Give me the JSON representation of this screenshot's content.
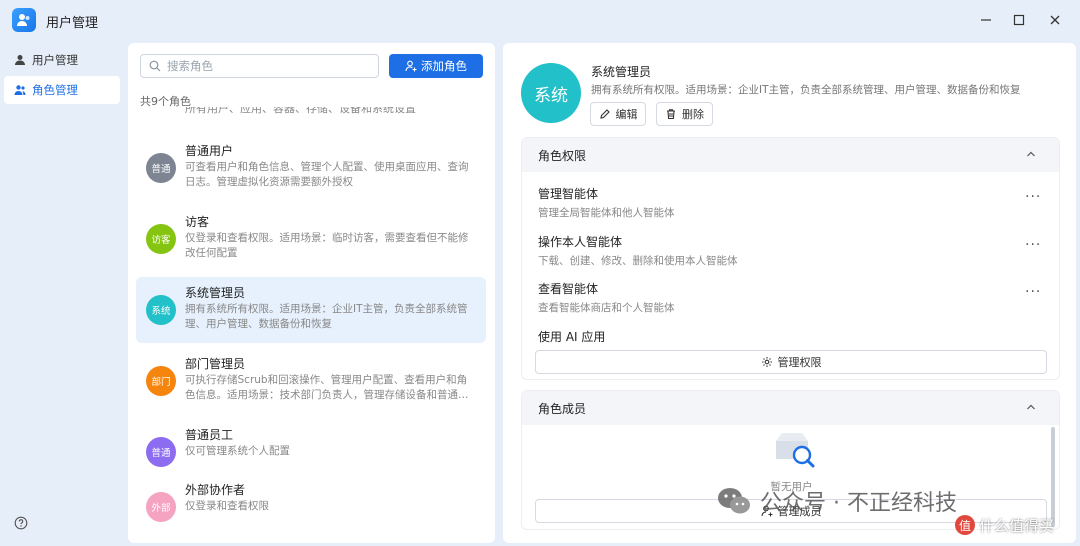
{
  "app": {
    "title": "用户管理"
  },
  "nav": {
    "items": [
      {
        "label": "用户管理"
      },
      {
        "label": "角色管理"
      }
    ]
  },
  "list": {
    "search_placeholder": "搜索角色",
    "add_label": "添加角色",
    "count_text": "共9个角色",
    "cut_text": "所有用户、应用、容器、存储、设备和系统设置",
    "roles": [
      {
        "avatar": "普通",
        "color": "#7d8593",
        "name": "普通用户",
        "desc": "可查看用户和角色信息、管理个人配置、使用桌面应用、查询日志。管理虚拟化资源需要额外授权"
      },
      {
        "avatar": "访客",
        "color": "#86c412",
        "name": "访客",
        "desc": "仅登录和查看权限。适用场景：临时访客，需要查看但不能修改任何配置"
      },
      {
        "avatar": "系统",
        "color": "#22c0c8",
        "name": "系统管理员",
        "desc": "拥有系统所有权限。适用场景：企业IT主管，负责全部系统管理、用户管理、数据备份和恢复"
      },
      {
        "avatar": "部门",
        "color": "#f5850c",
        "name": "部门管理员",
        "desc": "可执行存储Scrub和回滚操作、管理用户配置、查看用户和角色信息。适用场景：技术部门负责人，管理存储设备和普通…"
      },
      {
        "avatar": "普通",
        "color": "#8c6cf0",
        "name": "普通员工",
        "desc": "仅可管理系统个人配置"
      },
      {
        "avatar": "外部",
        "color": "#f5a3c0",
        "name": "外部协作者",
        "desc": "仅登录和查看权限"
      }
    ]
  },
  "detail": {
    "avatar": "系统",
    "title": "系统管理员",
    "desc": "拥有系统所有权限。适用场景：企业IT主管，负责全部系统管理、用户管理、数据备份和恢复",
    "edit_label": "编辑",
    "delete_label": "删除",
    "permissions": {
      "heading": "角色权限",
      "items": [
        {
          "name": "管理智能体",
          "desc": "管理全局智能体和他人智能体"
        },
        {
          "name": "操作本人智能体",
          "desc": "下载、创建、修改、删除和使用本人智能体"
        },
        {
          "name": "查看智能体",
          "desc": "查看智能体商店和个人智能体"
        },
        {
          "name": "使用 AI 应用",
          "desc": ""
        }
      ],
      "more_symbol": "···",
      "manage_label": "管理权限"
    },
    "members": {
      "heading": "角色成员",
      "empty_text": "暂无用户",
      "manage_label": "管理成员"
    }
  },
  "watermark": {
    "primary": "公众号 · 不正经科技",
    "secondary": "什么值得买",
    "secondary_icon": "值"
  },
  "colors": {
    "accent": "#1e6fe6",
    "background": "#e6eef9",
    "selected": "#e6f1fd"
  }
}
